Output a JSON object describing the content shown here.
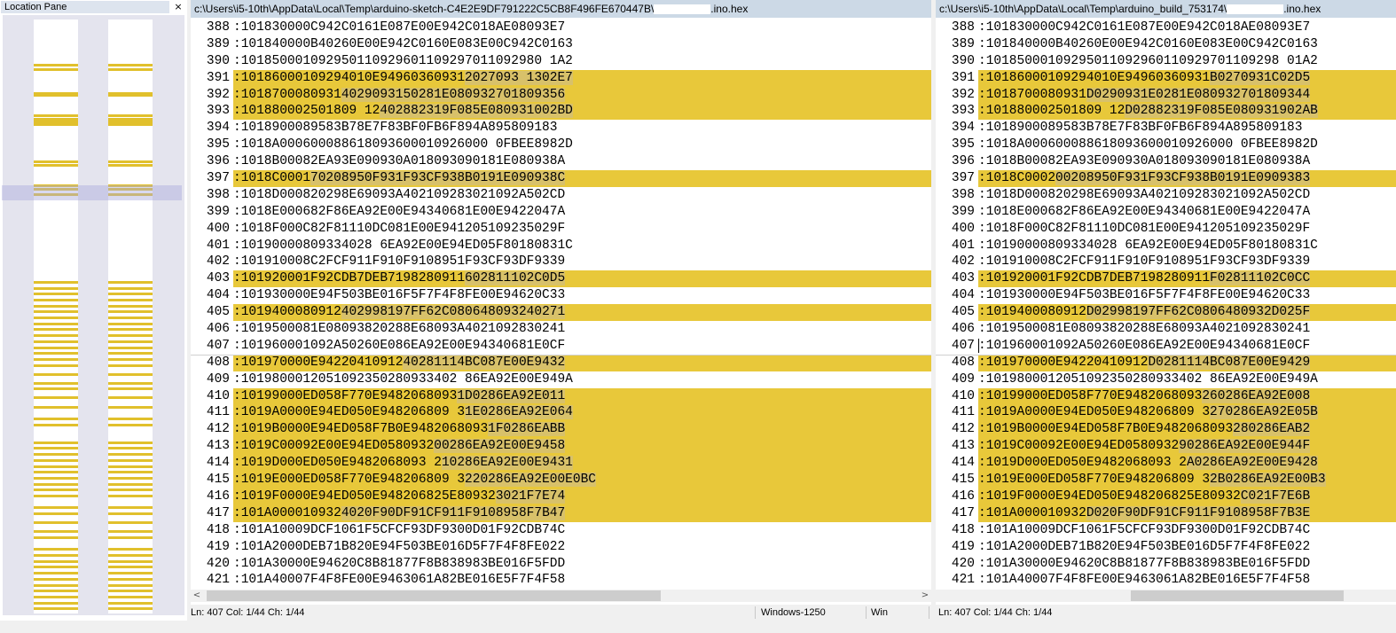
{
  "location_pane": {
    "title": "Location Pane",
    "close_glyph": "×",
    "marks_fraction": [
      0.075,
      0.082,
      0.122,
      0.126,
      0.16,
      0.165,
      0.17,
      0.174,
      0.238,
      0.244,
      0.278,
      0.284,
      0.292,
      0.44,
      0.45,
      0.46,
      0.47,
      0.48,
      0.49,
      0.5,
      0.51,
      0.52,
      0.53,
      0.54,
      0.55,
      0.56,
      0.57,
      0.58,
      0.595,
      0.61,
      0.62,
      0.635,
      0.65,
      0.67,
      0.68,
      0.71,
      0.72,
      0.73,
      0.74,
      0.75,
      0.76,
      0.77,
      0.78,
      0.79,
      0.8,
      0.82,
      0.83,
      0.845,
      0.86,
      0.87,
      0.89,
      0.9,
      0.91,
      0.92,
      0.93,
      0.94,
      0.95,
      0.96,
      0.97,
      0.98,
      0.99
    ]
  },
  "left": {
    "path": "c:\\Users\\i5-10th\\AppData\\Local\\Temp\\arduino-sketch-C4E2E9DF791222C5CB8F496FE670447B\\",
    "suffix": ".ino.hex",
    "rows": [
      {
        "n": "388",
        "t": ":101830000C942C0161E087E00E942C018AE08093E7",
        "d": false
      },
      {
        "n": "389",
        "t": ":101840000B40260E00E942C0160E083E00C942C0163",
        "d": false
      },
      {
        "n": "390",
        "t": ":101850001092950110929601109297011092980 1A2",
        "d": false
      },
      {
        "n": "391",
        "t": ":10186000109294010E94960360931",
        "h": "2027093 1302E7",
        "d": true
      },
      {
        "n": "392",
        "t": ":1018700080931",
        "h": "4029093150281E080932701809356",
        "d": true
      },
      {
        "n": "393",
        "t": ":101880002501809 12",
        "h": "402882319F085E080931002BD",
        "d": true
      },
      {
        "n": "394",
        "t": ":1018900089583B78E7F83BF0FB6F894A895809183",
        "d": false
      },
      {
        "n": "395",
        "t": ":1018A000600088618093600010926000 0FBEE8982D",
        "d": false
      },
      {
        "n": "396",
        "t": ":1018B00082EA93E090930A018093090181E080938A",
        "d": false
      },
      {
        "n": "397",
        "t": ":1018C0001",
        "h": "70208950F931F93CF938B0191E090938C",
        "d": true
      },
      {
        "n": "398",
        "t": ":1018D000820298E69093A402109283021092A502CD",
        "d": false
      },
      {
        "n": "399",
        "t": ":1018E000682F86EA92E00E94340681E00E9422047A",
        "d": false
      },
      {
        "n": "400",
        "t": ":1018F000C82F81110DC081E00E941205109235029F",
        "d": false
      },
      {
        "n": "401",
        "t": ":10190000809334028 6EA92E00E94ED05F80180831C",
        "d": false
      },
      {
        "n": "402",
        "t": ":101910008C2FCF911F910F9108951F93CF93DF9339",
        "d": false
      },
      {
        "n": "403",
        "t": ":101920001F92CDB7DEB7198280911",
        "h": "602811102C0D5",
        "d": true
      },
      {
        "n": "404",
        "t": ":101930000E94F503BE016F5F7F4F8FE00E94620C33",
        "d": false
      },
      {
        "n": "405",
        "t": ":1019400080912",
        "h": "402998197FF62C080648093240271",
        "d": true
      },
      {
        "n": "406",
        "t": ":1019500081E08093820288E68093A4021092830241",
        "d": false
      },
      {
        "n": "407",
        "t": ":101960001092A50260E086EA92E00E94340681E0CF",
        "d": false
      },
      {
        "n": "408",
        "t": ":101970000E94220410912",
        "h": "40281114BC087E00E9432",
        "d": true
      },
      {
        "n": "409",
        "t": ":1019800012051092350280933402 86EA92E00E949A",
        "d": false
      },
      {
        "n": "410",
        "t": ":10199000ED058F770E9482068093",
        "h": "1D0286EA92E011",
        "d": true
      },
      {
        "n": "411",
        "t": ":1019A0000E94ED050E948206809 3",
        "h": "1E0286EA92E064",
        "d": true
      },
      {
        "n": "412",
        "t": ":1019B0000E94ED058F7B0E9482068093",
        "h": "1F0286EABB",
        "d": true
      },
      {
        "n": "413",
        "t": ":1019C00092E00E94ED0580932",
        "h": "00286EA92E00E9458",
        "d": true
      },
      {
        "n": "414",
        "t": ":1019D000ED050E9482068093 2",
        "h": "10286EA92E00E9431",
        "d": true
      },
      {
        "n": "415",
        "t": ":1019E000ED058F770E948206809 3",
        "h": "220286EA92E00E0BC",
        "d": true
      },
      {
        "n": "416",
        "t": ":1019F0000E94ED050E948206825E80932",
        "h": "3021F7E74",
        "d": true
      },
      {
        "n": "417",
        "t": ":101A000010932",
        "h": "4020F90DF91CF911F9108958F7B47",
        "d": true
      },
      {
        "n": "418",
        "t": ":101A10009DCF1061F5CFCF93DF9300D01F92CDB74C",
        "d": false
      },
      {
        "n": "419",
        "t": ":101A2000DEB71B820E94F503BE016D5F7F4F8FE022",
        "d": false
      },
      {
        "n": "420",
        "t": ":101A30000E94620C8B81877F8B838983BE016F5FDD",
        "d": false
      },
      {
        "n": "421",
        "t": ":101A40007F4F8FE00E9463061A82BE016E5F7F4F58",
        "d": false
      }
    ]
  },
  "right": {
    "path": "c:\\Users\\i5-10th\\AppData\\Local\\Temp\\arduino_build_753174\\",
    "suffix": ".ino.hex",
    "rows": [
      {
        "n": "388",
        "t": ":101830000C942C0161E087E00E942C018AE08093E7",
        "d": false
      },
      {
        "n": "389",
        "t": ":101840000B40260E00E942C0160E083E00C942C0163",
        "d": false
      },
      {
        "n": "390",
        "t": ":10185000109295011092960110929701109298 01A2",
        "d": false
      },
      {
        "n": "391",
        "t": ":10186000109294010E94960360931",
        "h": "B0270931C02D5",
        "d": true
      },
      {
        "n": "392",
        "t": ":1018700080931",
        "h": "D0290931E0281E080932701809344",
        "d": true
      },
      {
        "n": "393",
        "t": ":101880002501809 12",
        "h": "D02882319F085E080931902AB",
        "d": true
      },
      {
        "n": "394",
        "t": ":1018900089583B78E7F83BF0FB6F894A895809183",
        "d": false
      },
      {
        "n": "395",
        "t": ":1018A000600088618093600010926000 0FBEE8982D",
        "d": false
      },
      {
        "n": "396",
        "t": ":1018B00082EA93E090930A018093090181E080938A",
        "d": false
      },
      {
        "n": "397",
        "t": ":1018C0002",
        "h": "00208950F931F93CF938B0191E0909383",
        "d": true
      },
      {
        "n": "398",
        "t": ":1018D000820298E69093A402109283021092A502CD",
        "d": false
      },
      {
        "n": "399",
        "t": ":1018E000682F86EA92E00E94340681E00E9422047A",
        "d": false
      },
      {
        "n": "400",
        "t": ":1018F000C82F81110DC081E00E941205109235029F",
        "d": false
      },
      {
        "n": "401",
        "t": ":10190000809334028 6EA92E00E94ED05F80180831C",
        "d": false
      },
      {
        "n": "402",
        "t": ":101910008C2FCF911F910F9108951F93CF93DF9339",
        "d": false
      },
      {
        "n": "403",
        "t": ":101920001F92CDB7DEB7198280911",
        "h": "F02811102C0CC",
        "d": true
      },
      {
        "n": "404",
        "t": ":101930000E94F503BE016F5F7F4F8FE00E94620C33",
        "d": false
      },
      {
        "n": "405",
        "t": ":1019400080912",
        "h": "D02998197FF62C0806480932D025F",
        "d": true
      },
      {
        "n": "406",
        "t": ":1019500081E08093820288E68093A4021092830241",
        "d": false
      },
      {
        "n": "407",
        "t": ":101960001092A50260E086EA92E00E94340681E0CF",
        "d": false
      },
      {
        "n": "408",
        "t": ":101970000E94220410912",
        "h": "D0281114BC087E00E9429",
        "d": true
      },
      {
        "n": "409",
        "t": ":1019800012051092350280933402 86EA92E00E949A",
        "d": false
      },
      {
        "n": "410",
        "t": ":10199000ED058F770E9482068093",
        "h": "260286EA92E008",
        "d": true
      },
      {
        "n": "411",
        "t": ":1019A0000E94ED050E948206809 3",
        "h": "270286EA92E05B",
        "d": true
      },
      {
        "n": "412",
        "t": ":1019B0000E94ED058F7B0E9482068093",
        "h": "280286EAB2",
        "d": true
      },
      {
        "n": "413",
        "t": ":1019C00092E00E94ED0580932",
        "h": "90286EA92E00E944F",
        "d": true
      },
      {
        "n": "414",
        "t": ":1019D000ED050E9482068093 2",
        "h": "A0286EA92E00E9428",
        "d": true
      },
      {
        "n": "415",
        "t": ":1019E000ED058F770E948206809 3",
        "h": "2B0286EA92E00B3",
        "d": true
      },
      {
        "n": "416",
        "t": ":1019F0000E94ED050E948206825E80932",
        "h": "C021F7E6B",
        "d": true
      },
      {
        "n": "417",
        "t": ":101A000010932",
        "h": "D020F90DF91CF911F9108958F7B3E",
        "d": true
      },
      {
        "n": "418",
        "t": ":101A10009DCF1061F5CFCF93DF9300D01F92CDB74C",
        "d": false
      },
      {
        "n": "419",
        "t": ":101A2000DEB71B820E94F503BE016D5F7F4F8FE022",
        "d": false
      },
      {
        "n": "420",
        "t": ":101A30000E94620C8B81877F8B838983BE016F5FDD",
        "d": false
      },
      {
        "n": "421",
        "t": ":101A40007F4F8FE00E9463061A82BE016E5F7F4F58",
        "d": false
      }
    ]
  },
  "status": {
    "left_pos": "Ln: 407  Col: 1/44  Ch: 1/44",
    "encoding": "Windows-1250",
    "eol": "Win",
    "right_pos": "Ln: 407  Col: 1/44  Ch: 1/44"
  },
  "colors": {
    "diff": "#e8c83a",
    "diff_inner": "#d8c16a",
    "header": "#ccd9e6"
  },
  "scroll_arrows": {
    "left": "<",
    "right": ">"
  }
}
